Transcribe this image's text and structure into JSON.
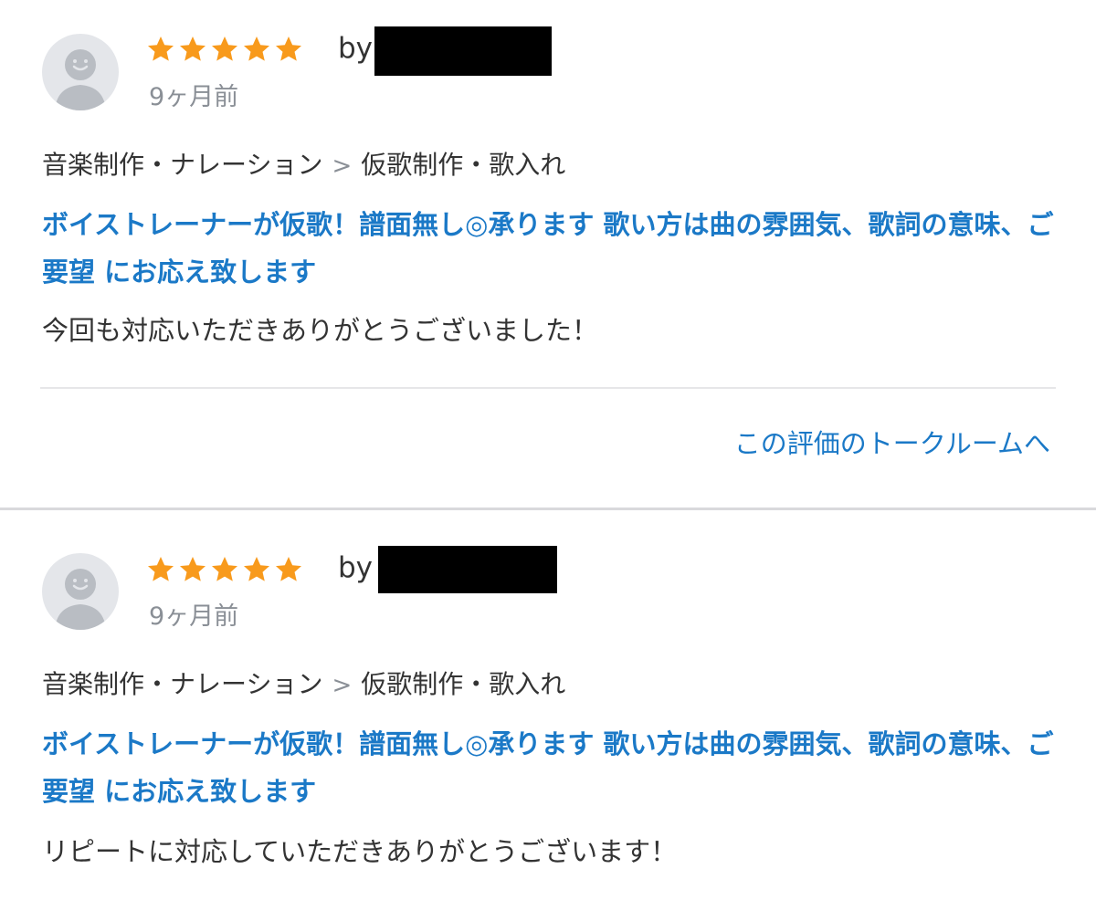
{
  "reviews": [
    {
      "rating": 5,
      "by_label": "by",
      "date": "9ヶ月前",
      "category": {
        "parent": "音楽制作・ナレーション",
        "separator": ">",
        "child": "仮歌制作・歌入れ"
      },
      "service_title": "ボイストレーナーが仮歌！譜面無し◎承ります 歌い方は曲の雰囲気、歌詞の意味、ご要望 にお応え致します",
      "comment": "今回も対応いただきありがとうございました！",
      "talkroom_link": "この評価のトークルームへ"
    },
    {
      "rating": 5,
      "by_label": "by",
      "date": "9ヶ月前",
      "category": {
        "parent": "音楽制作・ナレーション",
        "separator": ">",
        "child": "仮歌制作・歌入れ"
      },
      "service_title": "ボイストレーナーが仮歌！譜面無し◎承ります 歌い方は曲の雰囲気、歌詞の意味、ご要望 にお応え致します",
      "comment": "リピートに対応していただきありがとうございます！"
    }
  ],
  "colors": {
    "star": "#f89a1c",
    "link": "#1b79c7",
    "text": "#333333",
    "muted": "#8a8f96",
    "avatar_bg": "#e4e6ea",
    "avatar_fg": "#b9bdc3"
  },
  "icons": {
    "avatar": "default-user-avatar-icon",
    "star": "filled-star-icon"
  }
}
